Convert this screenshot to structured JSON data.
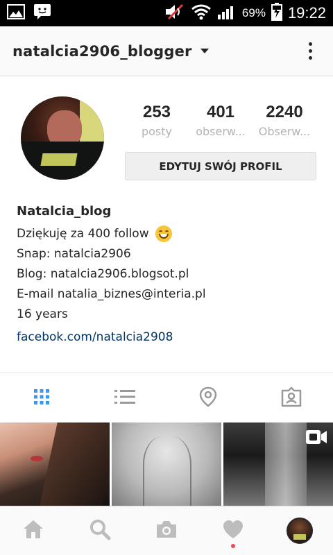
{
  "status_bar": {
    "battery_percent": "69%",
    "time": "19:22",
    "icons": [
      "image-notification-icon",
      "message-notification-icon",
      "mute-icon",
      "wifi-icon",
      "signal-icon",
      "battery-charging-icon"
    ]
  },
  "header": {
    "username": "natalcia2906_blogger",
    "icons": [
      "chevron-down-icon",
      "more-options-icon"
    ]
  },
  "profile": {
    "stats": [
      {
        "value": "253",
        "label": "posty"
      },
      {
        "value": "401",
        "label": "obserw..."
      },
      {
        "value": "2240",
        "label": "Obserw..."
      }
    ],
    "edit_button": "EDYTUJ SWÓJ PROFIL"
  },
  "bio": {
    "name": "Natalcia_blog",
    "lines": [
      "Dziękuję za 400 follow",
      "Snap: natalcia2906",
      "Blog: natalcia2906.blogsot.pl",
      "E-mail natalia_biznes@interia.pl",
      "16 years"
    ],
    "emoji": "grinning-face-icon",
    "link": "facebok.com/natalcia2908"
  },
  "tabs": [
    {
      "icon": "grid-icon",
      "active": true
    },
    {
      "icon": "list-icon",
      "active": false
    },
    {
      "icon": "location-pin-icon",
      "active": false
    },
    {
      "icon": "tagged-person-icon",
      "active": false
    }
  ],
  "bottom_nav": [
    {
      "icon": "home-icon"
    },
    {
      "icon": "search-icon"
    },
    {
      "icon": "camera-icon"
    },
    {
      "icon": "heart-icon",
      "notification": true
    },
    {
      "icon": "profile-avatar-icon",
      "active": true
    }
  ],
  "colors": {
    "active_tab": "#3897f0",
    "inactive_icon": "#999999",
    "link": "#003569",
    "notification_dot": "#ed4956"
  }
}
